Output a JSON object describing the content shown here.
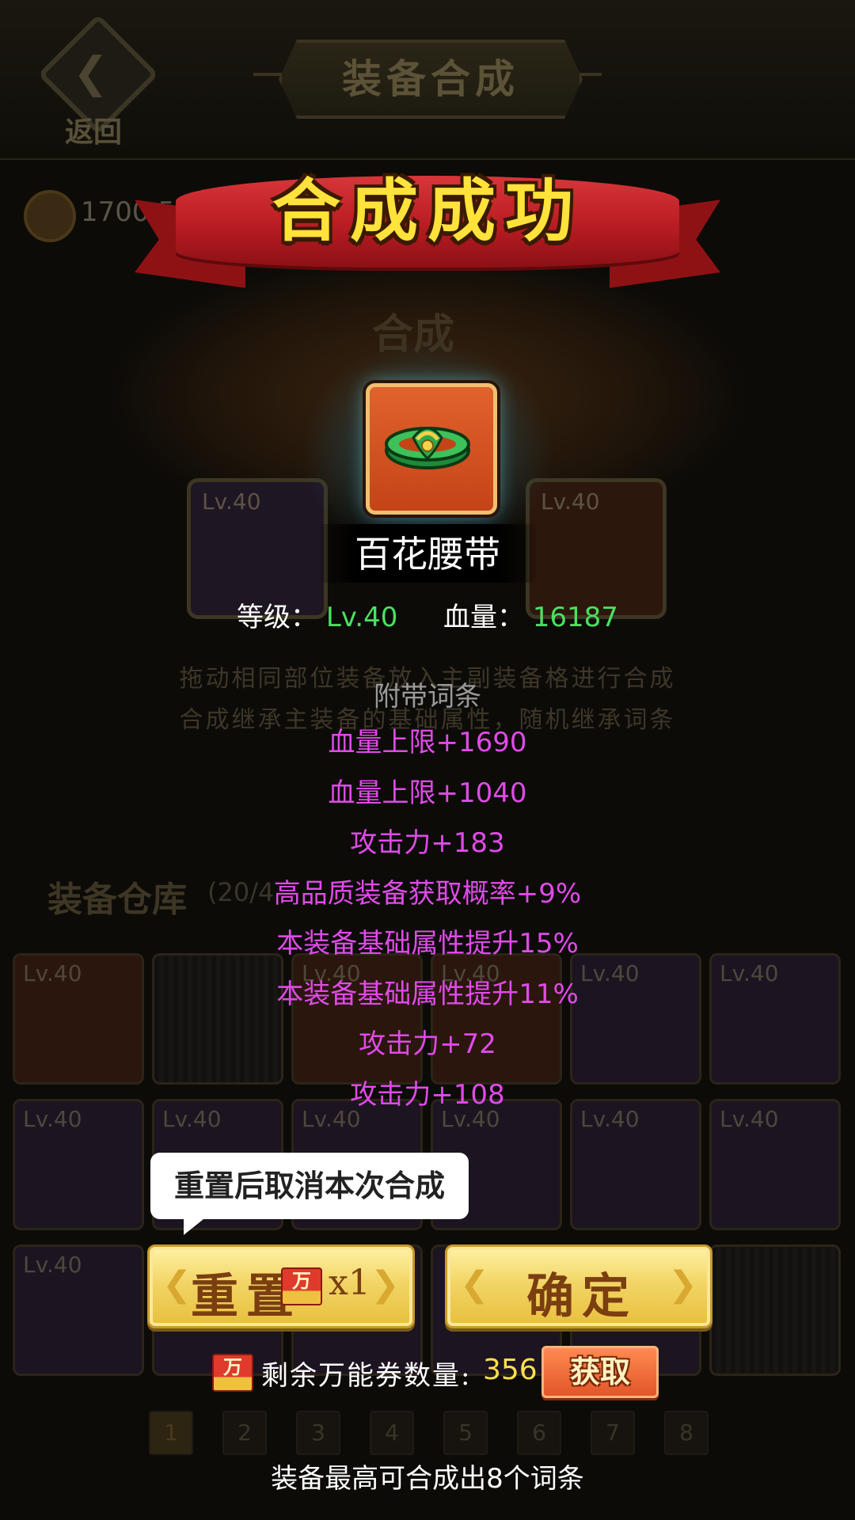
{
  "background": {
    "back_label": "返回",
    "screen_title": "装备合成",
    "coin_value": "1700 5",
    "emblem_label": "合成",
    "main_slot_level": "Lv.40",
    "sub_slot_level": "Lv.40",
    "hint_line1": "拖动相同部位装备放入主副装备格进行合成",
    "hint_line2": "合成继承主装备的基础属性，随机继承词条",
    "warehouse_title": "装备仓库",
    "warehouse_count": "(20/4",
    "inventory": [
      {
        "level": "Lv.40",
        "tone": "orange"
      },
      {
        "level": "",
        "tone": "empty"
      },
      {
        "level": "Lv.40",
        "tone": "orange"
      },
      {
        "level": "Lv.40",
        "tone": "orange"
      },
      {
        "level": "Lv.40",
        "tone": "purple"
      },
      {
        "level": "Lv.40",
        "tone": "purple"
      },
      {
        "level": "Lv.40",
        "tone": "purple"
      },
      {
        "level": "Lv.40",
        "tone": "purple"
      },
      {
        "level": "Lv.40",
        "tone": "purple"
      },
      {
        "level": "Lv.40",
        "tone": "purple"
      },
      {
        "level": "Lv.40",
        "tone": "purple"
      },
      {
        "level": "Lv.40",
        "tone": "purple"
      },
      {
        "level": "Lv.40",
        "tone": "purple"
      },
      {
        "level": "",
        "tone": "purple"
      },
      {
        "level": "",
        "tone": "purple"
      },
      {
        "level": "",
        "tone": "purple"
      },
      {
        "level": "",
        "tone": "purple"
      },
      {
        "level": "",
        "tone": "empty"
      }
    ],
    "pages": [
      "1",
      "2",
      "3",
      "4",
      "5",
      "6",
      "7",
      "8"
    ],
    "active_page": "1"
  },
  "modal": {
    "banner_title": "合成成功",
    "item_name": "百花腰带",
    "level_label": "等级：",
    "level_value": "Lv.40",
    "hp_label": "血量：",
    "hp_value": "16187",
    "affix_title": "附带词条",
    "affixes": [
      "血量上限+1690",
      "血量上限+1040",
      "攻击力+183",
      "高品质装备获取概率+9%",
      "本装备基础属性提升15%",
      "本装备基础属性提升11%",
      "攻击力+72",
      "攻击力+108"
    ],
    "tooltip": "重置后取消本次合成",
    "reset_label": "重置",
    "reset_cost": "x1",
    "confirm_label": "确定",
    "ticket_glyph": "万",
    "remaining_label": "剩余万能券数量:",
    "remaining_value": "356",
    "get_label": "获取",
    "footer": "装备最高可合成出8个词条"
  },
  "colors": {
    "affix": "#e04ae8",
    "stat_value": "#4be060",
    "banner_text": "#ffe23a",
    "ticket_count": "#ffe04a"
  },
  "icons": {
    "back": "back-arrow-icon",
    "item": "jade-belt-icon",
    "ticket": "universal-ticket-icon",
    "coin": "coin-icon"
  }
}
